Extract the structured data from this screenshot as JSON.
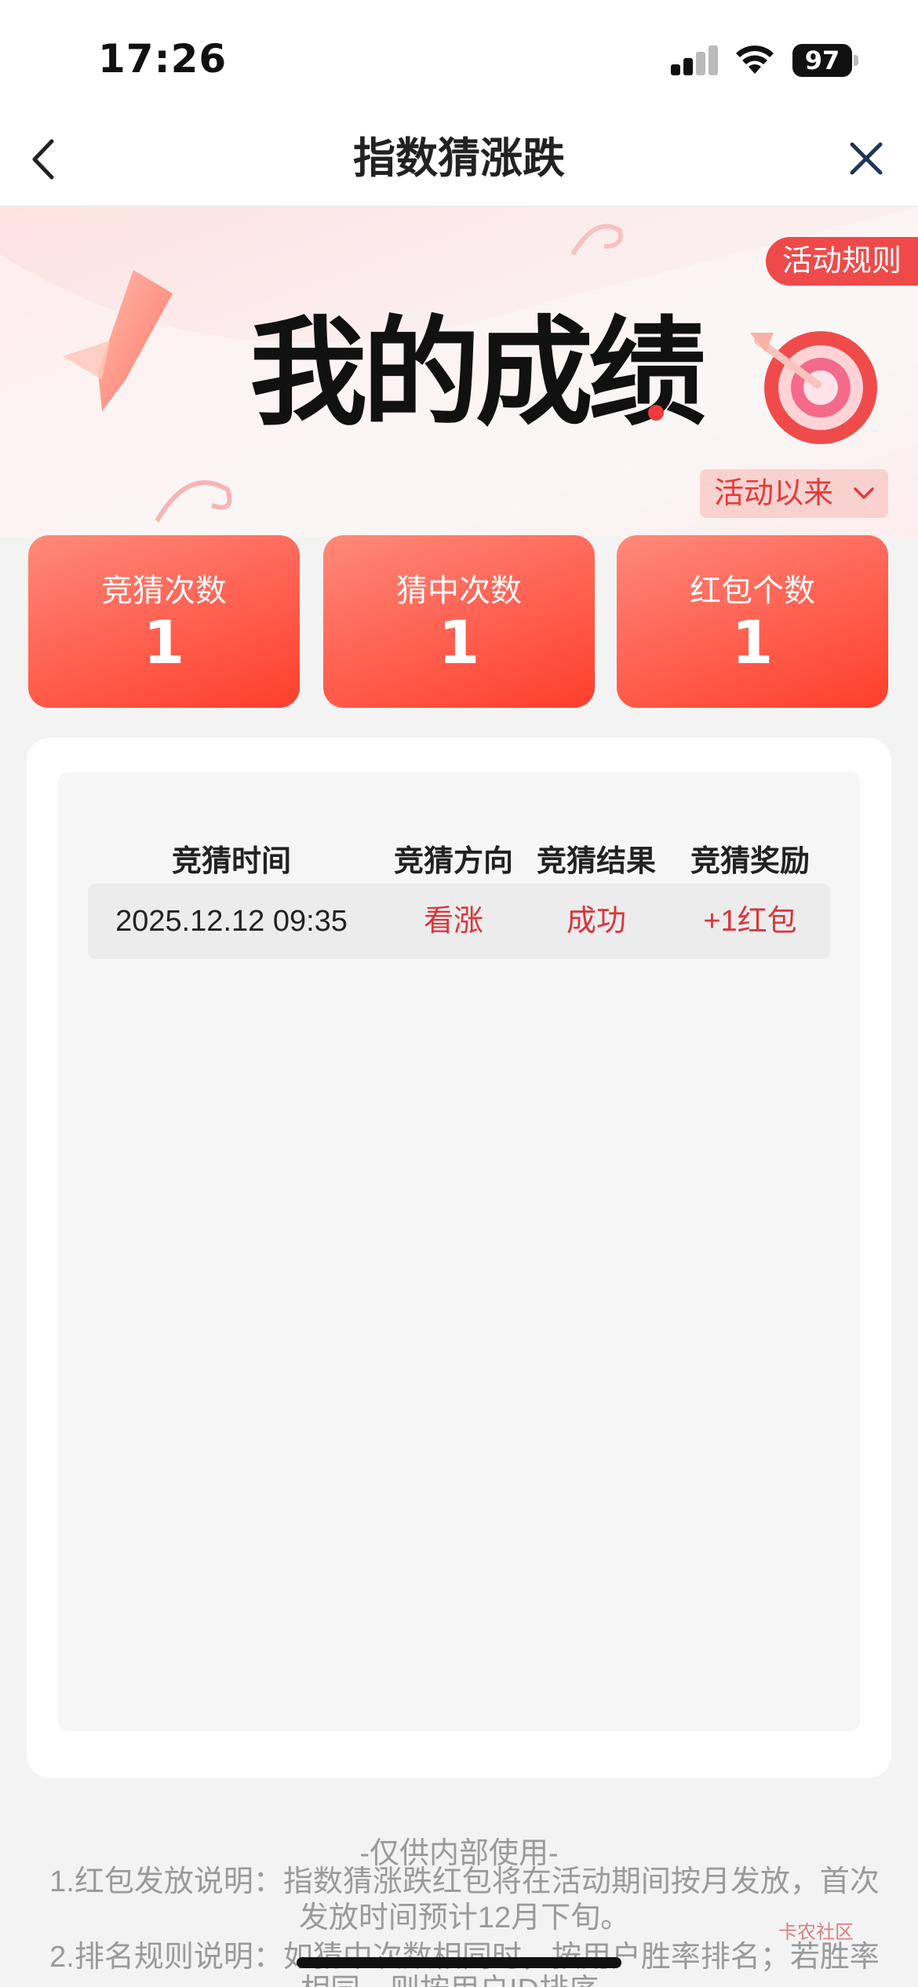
{
  "status_bar": {
    "time": "17:26",
    "battery": "97"
  },
  "nav": {
    "title": "指数猜涨跌"
  },
  "banner": {
    "title": "我的成绩",
    "rules_label": "活动规则",
    "period_label": "活动以来"
  },
  "stats": [
    {
      "label": "竞猜次数",
      "value": "1"
    },
    {
      "label": "猜中次数",
      "value": "1"
    },
    {
      "label": "红包个数",
      "value": "1"
    }
  ],
  "table": {
    "headers": [
      "竞猜时间",
      "竞猜方向",
      "竞猜结果",
      "竞猜奖励"
    ],
    "rows": [
      {
        "time": "2025.12.12 09:35",
        "direction": "看涨",
        "result": "成功",
        "reward": "+1红包"
      }
    ]
  },
  "footer": {
    "title": "-仅供内部使用-",
    "note1_line1": "1.红包发放说明：指数猜涨跌红包将在活动期间按月发放，首次",
    "note1_line2": "发放时间预计12月下旬。",
    "note2_line1": "2.排名规则说明：如猜中次数相同时，按用户胜率排名；若胜率",
    "note2_line2": "相同，则按用户ID排序。",
    "watermark": "卡农社区"
  },
  "colors": {
    "accent": "#ef4a4a",
    "card_gradient_end": "#ff3f2c",
    "positive": "#d8363a"
  }
}
